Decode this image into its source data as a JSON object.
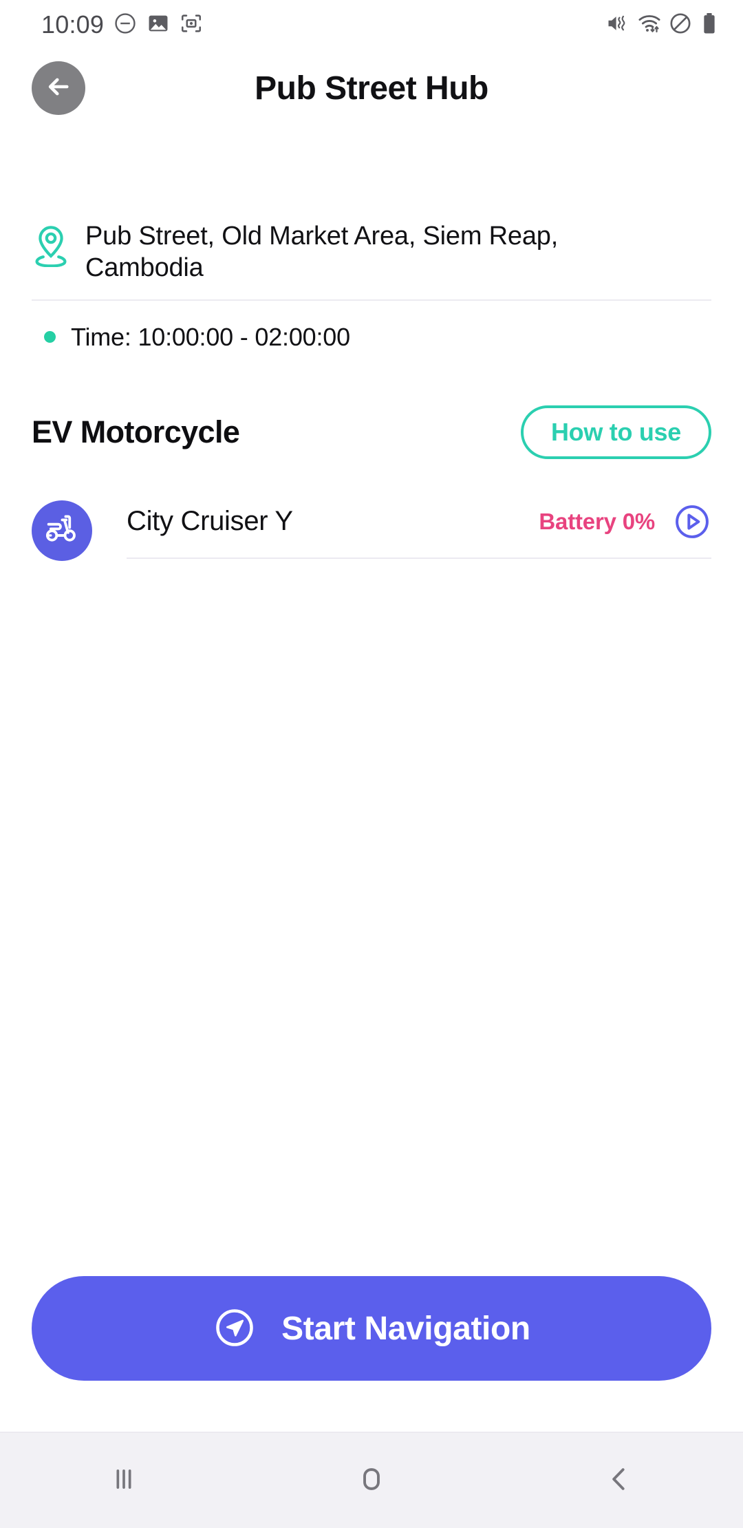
{
  "status_bar": {
    "time": "10:09",
    "left_icons": [
      "do-not-disturb-icon",
      "screenshot-image-icon",
      "screen-capture-icon"
    ],
    "right_icons": [
      "mute-vibrate-icon",
      "wifi-icon",
      "no-entry-icon",
      "battery-full-icon"
    ]
  },
  "header": {
    "title": "Pub Street Hub",
    "back_icon": "arrow-left-icon"
  },
  "location": {
    "icon": "map-pin-icon",
    "address": "Pub Street, Old Market Area, Siem Reap, Cambodia",
    "time_label": "Time: 10:00:00 - 02:00:00"
  },
  "section": {
    "title": "EV Motorcycle",
    "how_to_use_label": "How to use"
  },
  "vehicle": {
    "icon": "scooter-icon",
    "name": "City Cruiser Y",
    "battery_label": "Battery 0%",
    "play_icon": "play-circle-icon"
  },
  "cta": {
    "label": "Start Navigation",
    "icon": "navigation-arrow-icon"
  },
  "nav_bar": {
    "recents_icon": "recents-icon",
    "home_icon": "home-icon",
    "back_icon": "back-chevron-icon"
  },
  "colors": {
    "accent_teal": "#2bcfb0",
    "accent_purple": "#5b5fec",
    "battery_pink": "#e8437f",
    "dot_green": "#25cfa4",
    "back_button_gray": "#808083",
    "nav_bar_bg": "#f2f1f5"
  }
}
